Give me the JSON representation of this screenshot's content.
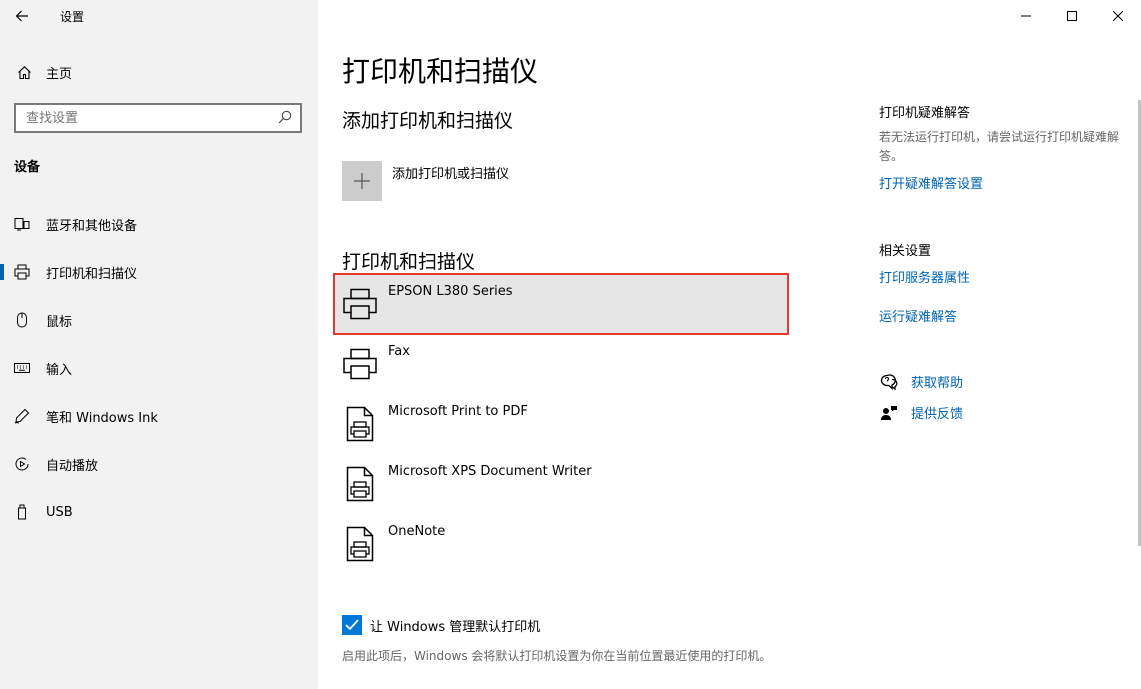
{
  "app": {
    "title": "设置"
  },
  "sidebar": {
    "home_label": "主页",
    "search_placeholder": "查找设置",
    "section_label": "设备",
    "items": [
      {
        "label": "蓝牙和其他设备",
        "icon": "bluetooth-devices-icon"
      },
      {
        "label": "打印机和扫描仪",
        "icon": "printer-icon",
        "active": true
      },
      {
        "label": "鼠标",
        "icon": "mouse-icon"
      },
      {
        "label": "输入",
        "icon": "keyboard-icon"
      },
      {
        "label": "笔和 Windows Ink",
        "icon": "pen-icon"
      },
      {
        "label": "自动播放",
        "icon": "autoplay-icon"
      },
      {
        "label": "USB",
        "icon": "usb-icon"
      }
    ]
  },
  "main": {
    "title": "打印机和扫描仪",
    "add_heading": "添加打印机和扫描仪",
    "add_label": "添加打印机或扫描仪",
    "list_heading": "打印机和扫描仪",
    "printers": [
      {
        "name": "EPSON L380 Series",
        "icon": "printer-icon",
        "selected": true
      },
      {
        "name": "Fax",
        "icon": "printer-icon"
      },
      {
        "name": "Microsoft Print to PDF",
        "icon": "document-printer-icon"
      },
      {
        "name": "Microsoft XPS Document Writer",
        "icon": "document-printer-icon"
      },
      {
        "name": "OneNote",
        "icon": "document-printer-icon"
      }
    ],
    "manage_default": {
      "label": "让 Windows 管理默认打印机",
      "checked": true,
      "description": "启用此项后，Windows 会将默认打印机设置为你在当前位置最近使用的打印机。"
    }
  },
  "right": {
    "troubleshoot_heading": "打印机疑难解答",
    "troubleshoot_text": "若无法运行打印机，请尝试运行打印机疑难解答。",
    "troubleshoot_link": "打开疑难解答设置",
    "related_heading": "相关设置",
    "related_links": [
      "打印服务器属性",
      "运行疑难解答"
    ],
    "help_label": "获取帮助",
    "feedback_label": "提供反馈"
  },
  "colors": {
    "accent": "#0063b1",
    "checkbox": "#0078d7",
    "highlight_border": "#e53935",
    "sidebar_bg": "#f2f2f2",
    "selected_bg": "#e6e6e6"
  }
}
